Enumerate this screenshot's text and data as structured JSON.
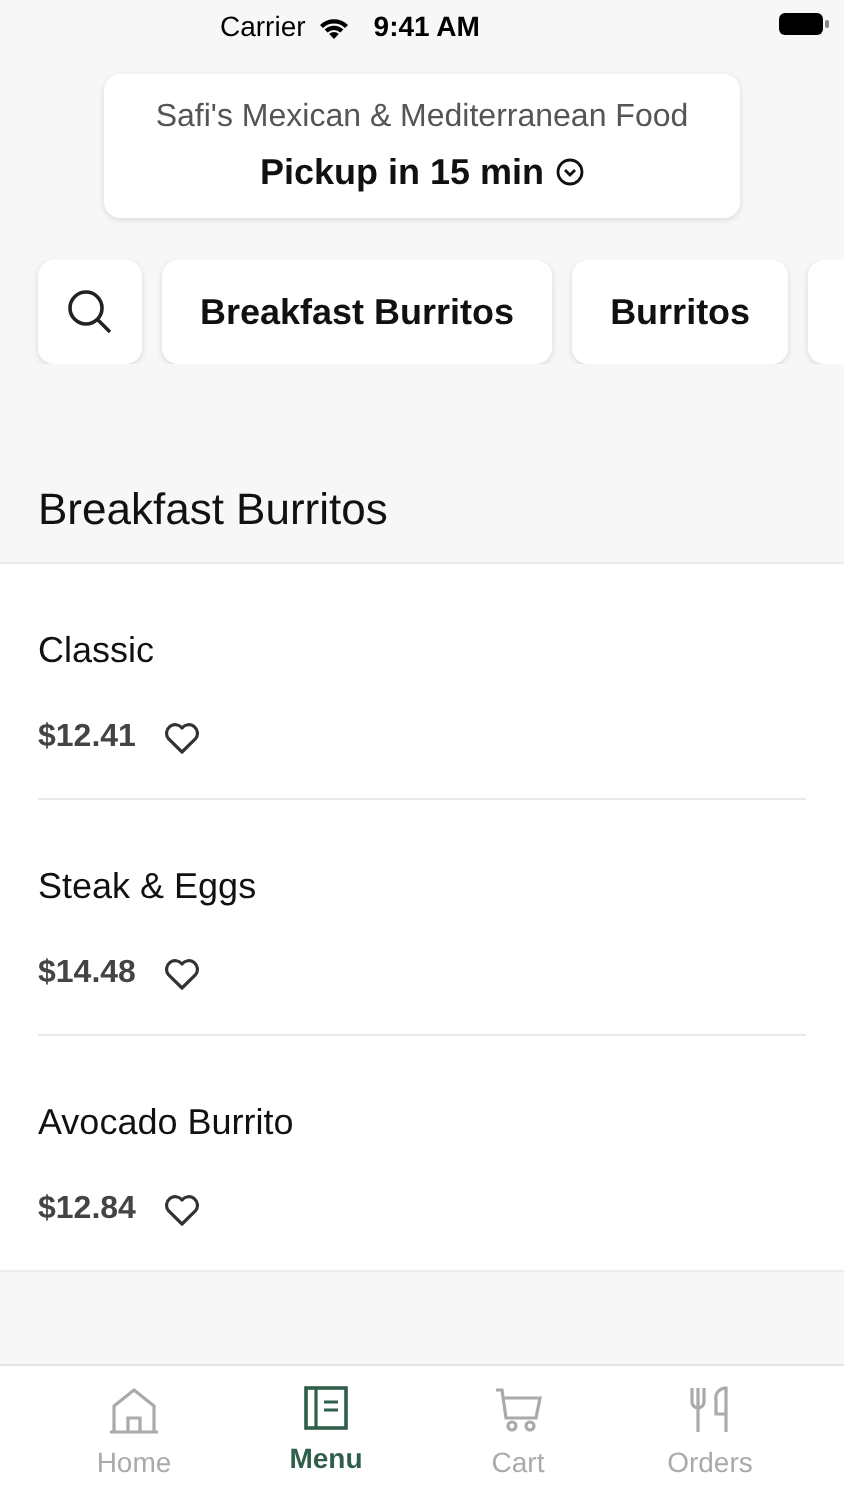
{
  "status_bar": {
    "carrier": "Carrier",
    "time": "9:41 AM"
  },
  "header": {
    "restaurant": "Safi's Mexican & Mediterranean Food",
    "pickup": "Pickup in 15 min"
  },
  "categories": [
    {
      "label": "Breakfast Burritos"
    },
    {
      "label": "Burritos"
    }
  ],
  "section": {
    "title": "Breakfast Burritos"
  },
  "items": [
    {
      "name": "Classic",
      "price": "$12.41",
      "favorite": false
    },
    {
      "name": "Steak & Eggs",
      "price": "$14.48",
      "favorite": false
    },
    {
      "name": "Avocado Burrito",
      "price": "$12.84",
      "favorite": false
    }
  ],
  "tabs": [
    {
      "kind": "home",
      "label": "Home",
      "selected": false
    },
    {
      "kind": "menu",
      "label": "Menu",
      "selected": true
    },
    {
      "kind": "cart",
      "label": "Cart",
      "selected": false
    },
    {
      "kind": "orders",
      "label": "Orders",
      "selected": false
    }
  ]
}
